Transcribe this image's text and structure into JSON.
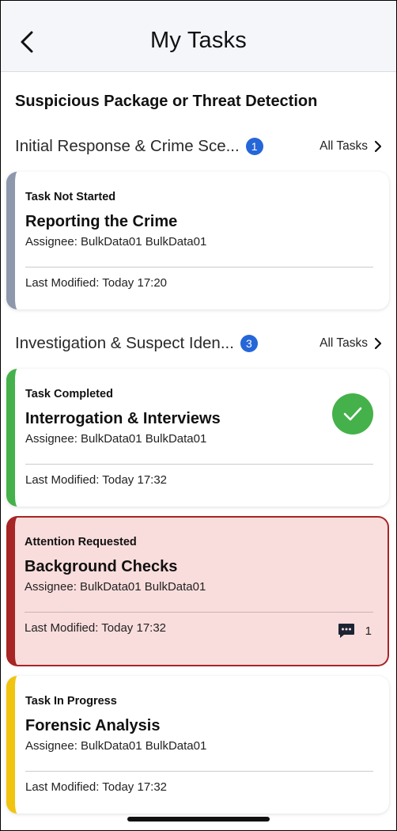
{
  "header": {
    "title": "My Tasks",
    "back_icon": "chevron-left-icon"
  },
  "main_title": "Suspicious Package or Threat Detection",
  "sections": [
    {
      "name": "Initial Response & Crime Sce...",
      "count": "1",
      "all_tasks_label": "All Tasks",
      "tasks": [
        {
          "status": "Task Not Started",
          "name": "Reporting the Crime",
          "assignee": "Assignee: BulkData01 BulkData01",
          "last_modified": "Last Modified: Today 17:20",
          "accent": "#8e98ad"
        }
      ]
    },
    {
      "name": "Investigation & Suspect Iden...",
      "count": "3",
      "all_tasks_label": "All Tasks",
      "tasks": [
        {
          "status": "Task Completed",
          "name": "Interrogation & Interviews",
          "assignee": "Assignee: BulkData01 BulkData01",
          "last_modified": "Last Modified: Today 17:32",
          "accent": "#45b14a",
          "icon": "check-circle-icon"
        },
        {
          "status": "Attention Requested",
          "name": "Background Checks",
          "assignee": "Assignee: BulkData01 BulkData01",
          "last_modified": "Last Modified: Today 17:32",
          "accent": "#a72525",
          "comment_count": "1",
          "icon": "comment-icon"
        },
        {
          "status": "Task In Progress",
          "name": "Forensic Analysis",
          "assignee": "Assignee: BulkData01 BulkData01",
          "last_modified": "Last Modified: Today 17:32",
          "accent": "#f1c40f"
        }
      ]
    }
  ],
  "colors": {
    "badge": "#2566d8",
    "completed": "#45b14a",
    "attention_bg": "#f9dddc",
    "attention_border": "#a72525",
    "in_progress": "#f1c40f",
    "not_started": "#8e98ad"
  }
}
